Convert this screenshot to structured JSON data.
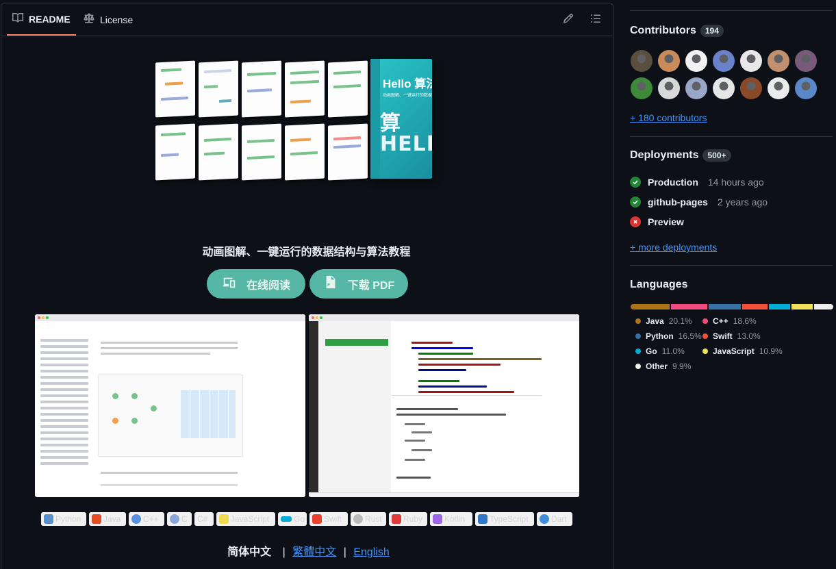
{
  "readme": {
    "tabs": [
      {
        "label": "README",
        "active": true
      },
      {
        "label": "License",
        "active": false
      }
    ],
    "tagline": "动画图解、一键运行的数据结构与算法教程",
    "buttons": {
      "read_online": "在线阅读",
      "download_pdf": "下载 PDF"
    },
    "book": {
      "title": "Hello 算法",
      "subtitle": "动画图解、一键运行的数据结构与算法教程"
    },
    "badges": [
      "Python",
      "Java",
      "C++",
      "C",
      "C#",
      "JavaScript",
      "Go",
      "Swift",
      "Rust",
      "Ruby",
      "Kotlin",
      "TypeScript",
      "Dart"
    ],
    "language_links": {
      "current": "简体中文",
      "separator": "|",
      "traditional": "繁體中文",
      "english": "English"
    }
  },
  "sidebar": {
    "contributors": {
      "title": "Contributors",
      "count": "194",
      "more_link": "+ 180 contributors",
      "avatar_colors": [
        "#5a4f3f",
        "#c98b5a",
        "#f2f2f2",
        "#6a82c9",
        "#e8e8e8",
        "#c2906f",
        "#7a5a7a",
        "#3c8a3a",
        "#d9d9d9",
        "#9aa6c8",
        "#e6e6e6",
        "#8a4a2a",
        "#ececec",
        "#5b86c8"
      ]
    },
    "deployments": {
      "title": "Deployments",
      "count": "500+",
      "items": [
        {
          "name": "Production",
          "time": "14 hours ago",
          "status": "success"
        },
        {
          "name": "github-pages",
          "time": "2 years ago",
          "status": "success"
        },
        {
          "name": "Preview",
          "time": "",
          "status": "failure"
        }
      ],
      "more_link": "+ more deployments"
    },
    "languages": {
      "title": "Languages",
      "items": [
        {
          "name": "Java",
          "percent": "20.1%",
          "value": 20.1,
          "color": "#b07219"
        },
        {
          "name": "C++",
          "percent": "18.6%",
          "value": 18.6,
          "color": "#f34b7d"
        },
        {
          "name": "Python",
          "percent": "16.5%",
          "value": 16.5,
          "color": "#3572A5"
        },
        {
          "name": "Swift",
          "percent": "13.0%",
          "value": 13.0,
          "color": "#F05138"
        },
        {
          "name": "Go",
          "percent": "11.0%",
          "value": 11.0,
          "color": "#00ADD8"
        },
        {
          "name": "JavaScript",
          "percent": "10.9%",
          "value": 10.9,
          "color": "#f1e05a"
        },
        {
          "name": "Other",
          "percent": "9.9%",
          "value": 9.9,
          "color": "#ededed"
        }
      ]
    }
  }
}
